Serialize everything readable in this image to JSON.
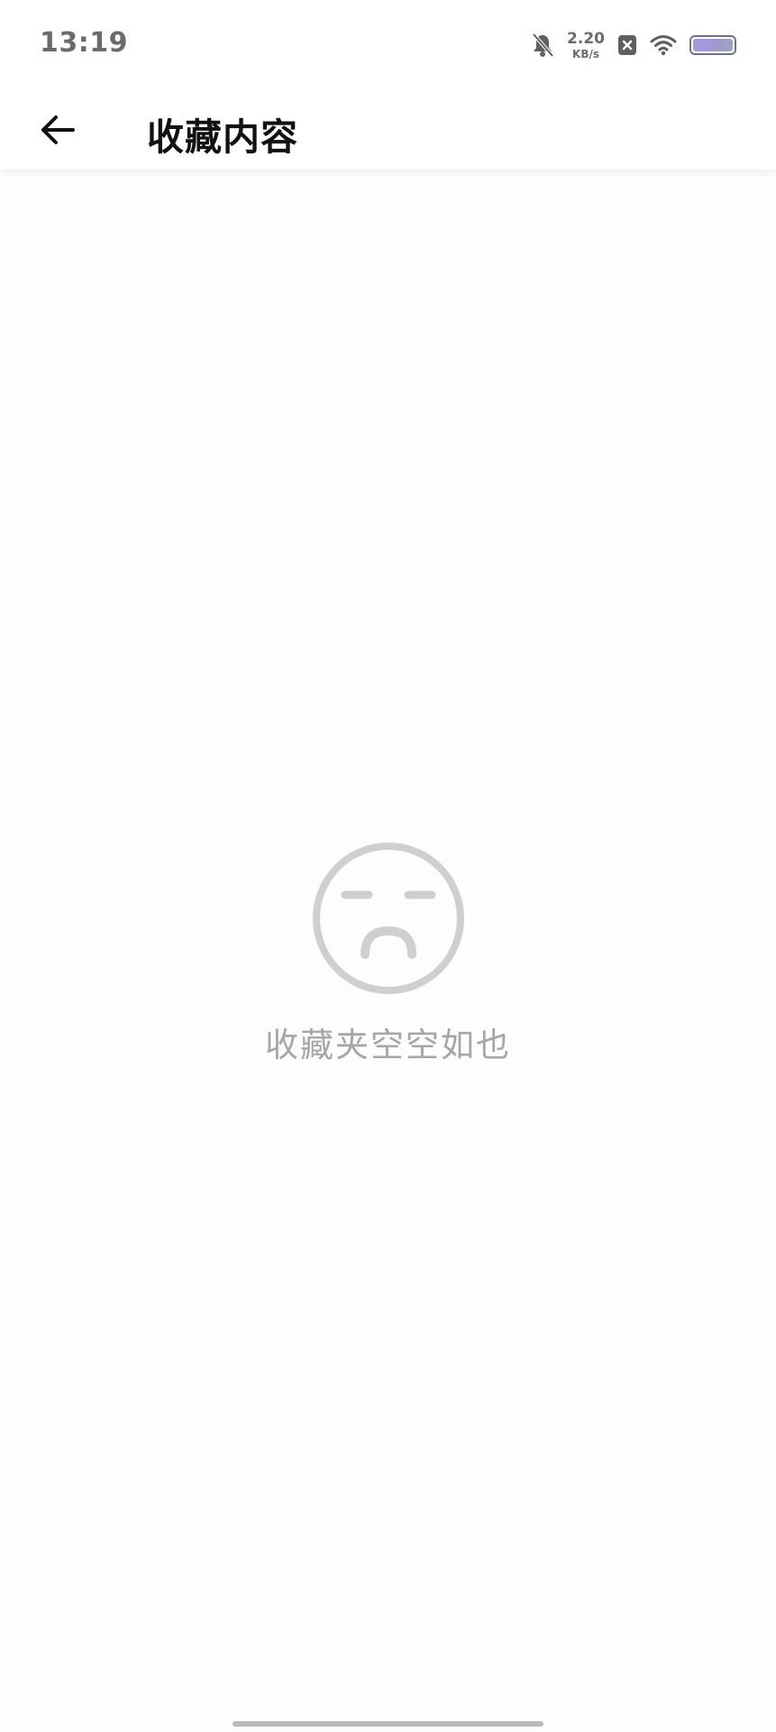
{
  "status_bar": {
    "time": "13:19",
    "net_speed_value": "2.20",
    "net_speed_unit": "KB/s",
    "icons": [
      "bell-muted-icon",
      "notification-x-icon",
      "wifi-icon",
      "battery-icon"
    ]
  },
  "app_bar": {
    "title": "收藏内容",
    "back_icon": "arrow-left-icon"
  },
  "empty_state": {
    "icon": "sad-face-icon",
    "message": "收藏夹空空如也"
  },
  "colors": {
    "background": "#fdfdfd",
    "title_text": "#111111",
    "empty_text": "#a6a6a6",
    "empty_icon": "#cfcfcf",
    "status_text": "#6b6b6b"
  }
}
